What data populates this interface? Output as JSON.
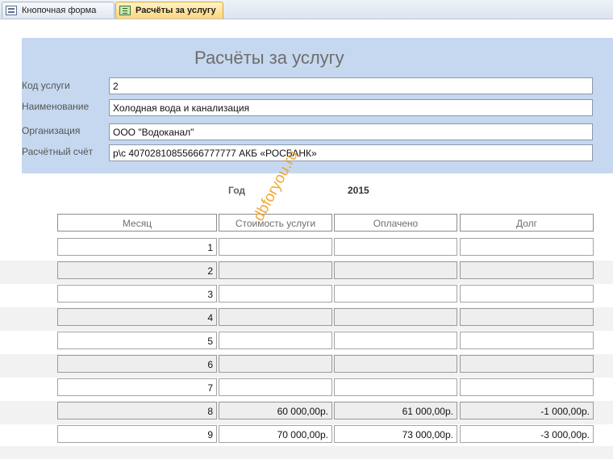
{
  "tabs": [
    {
      "label": "Кнопочная форма",
      "icon": "form-icon",
      "active": false
    },
    {
      "label": "Расчёты за услугу",
      "icon": "report-icon",
      "active": true
    }
  ],
  "report": {
    "title": "Расчёты за услугу",
    "fields": [
      {
        "label": "Код услуги",
        "value": "2"
      },
      {
        "label": "Наименование",
        "value": "Холодная вода и канализация"
      },
      {
        "label": "Организация",
        "value": "ООО \"Водоканал\""
      },
      {
        "label": "Расчётный счёт",
        "value": "р\\с 40702810855666777777 АКБ «РОСБАНК»"
      }
    ],
    "year_label": "Год",
    "year_value": "2015",
    "columns": [
      "Месяц",
      "Стоимость услуги",
      "Оплачено",
      "Долг"
    ],
    "rows": [
      {
        "month": "1",
        "cost": "",
        "paid": "",
        "debt": ""
      },
      {
        "month": "2",
        "cost": "",
        "paid": "",
        "debt": ""
      },
      {
        "month": "3",
        "cost": "",
        "paid": "",
        "debt": ""
      },
      {
        "month": "4",
        "cost": "",
        "paid": "",
        "debt": ""
      },
      {
        "month": "5",
        "cost": "",
        "paid": "",
        "debt": ""
      },
      {
        "month": "6",
        "cost": "",
        "paid": "",
        "debt": ""
      },
      {
        "month": "7",
        "cost": "",
        "paid": "",
        "debt": ""
      },
      {
        "month": "8",
        "cost": "60 000,00р.",
        "paid": "61 000,00р.",
        "debt": "-1 000,00р."
      },
      {
        "month": "9",
        "cost": "70 000,00р.",
        "paid": "73 000,00р.",
        "debt": "-3 000,00р."
      }
    ]
  },
  "watermark": "dbforyou.ru",
  "colors": {
    "header_bg": "#c6d8ef",
    "active_tab": "#ffd57a",
    "watermark": "#f0a020"
  }
}
